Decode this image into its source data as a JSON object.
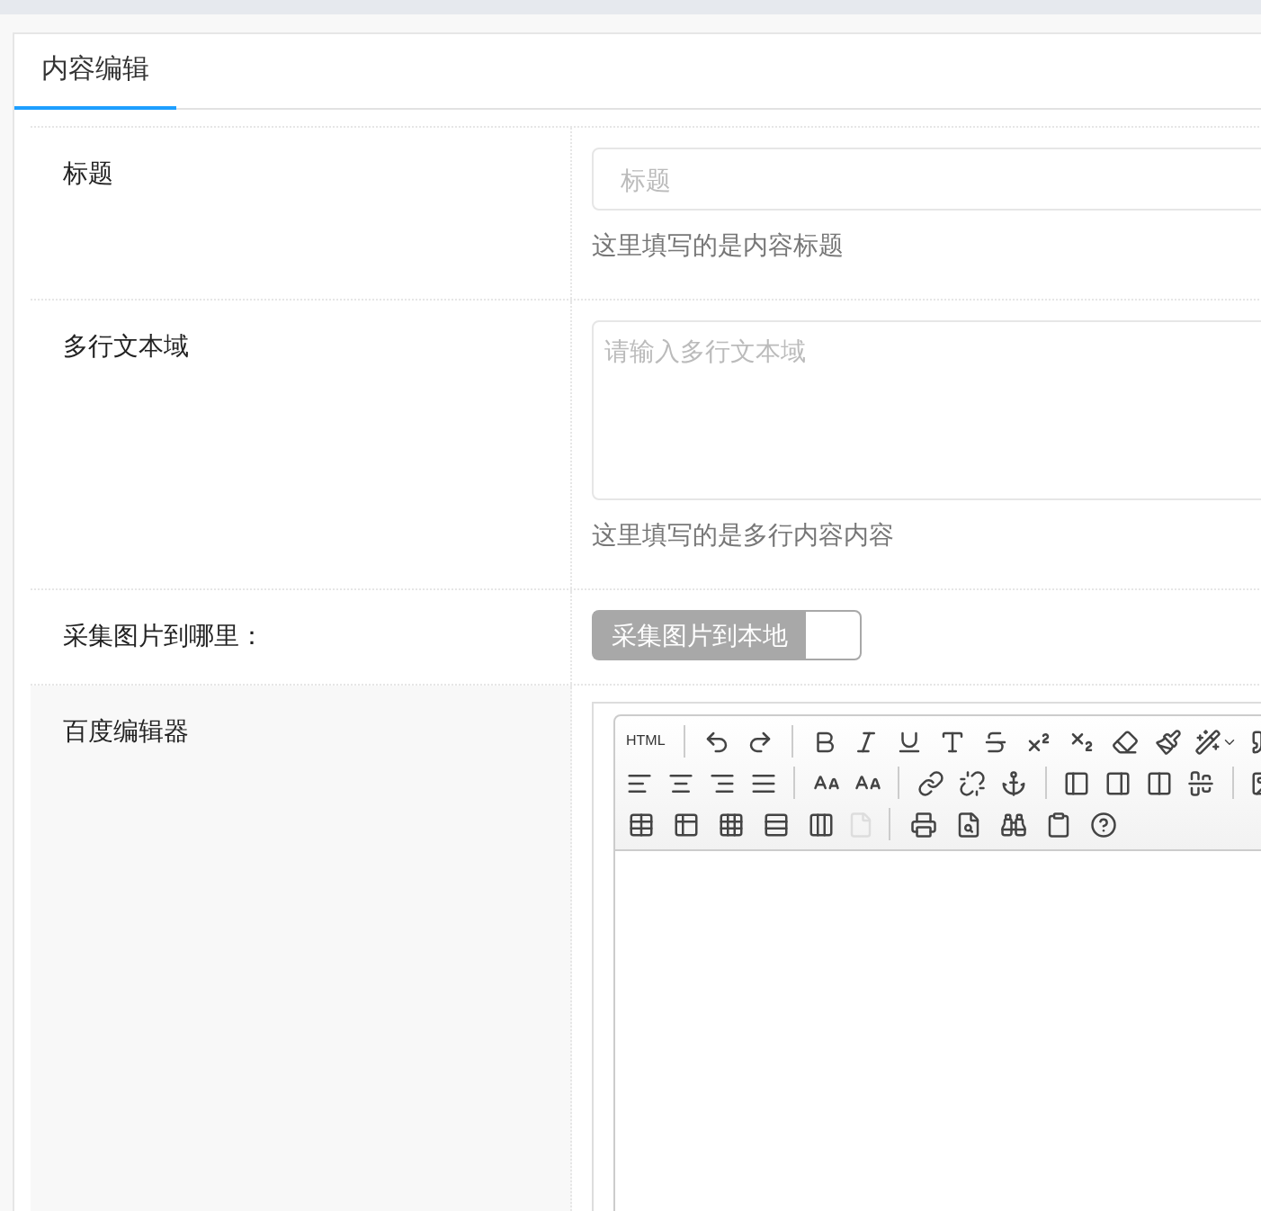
{
  "tabs": [
    {
      "label": "内容编辑",
      "selected": true
    }
  ],
  "fields": [
    {
      "kind": "text",
      "label": "标题",
      "placeholder": "标题",
      "help": "这里填写的是内容标题"
    },
    {
      "kind": "textarea",
      "label": "多行文本域",
      "placeholder": "请输入多行文本域",
      "help": "这里填写的是多行内容内容"
    },
    {
      "kind": "switch",
      "label": "采集图片到哪里：",
      "switch_text": "采集图片到本地",
      "on": false
    },
    {
      "kind": "editor",
      "label": "百度编辑器",
      "source_button": "HTML"
    }
  ]
}
